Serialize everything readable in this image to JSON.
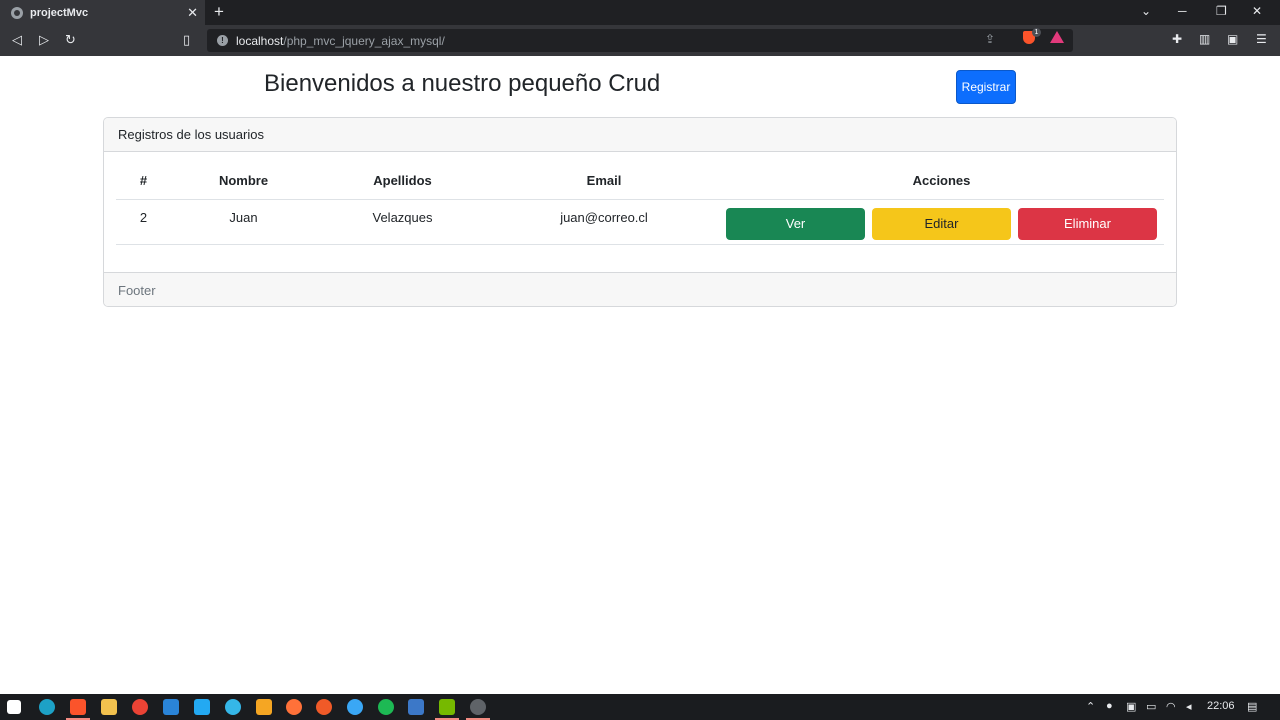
{
  "browser": {
    "tab_title": "projectMvc",
    "tab_close": "✕",
    "new_tab": "+",
    "url_host": "localhost",
    "url_path": "/php_mvc_jquery_ajax_mysql/",
    "shield_count": "1",
    "window_minimize": "─",
    "window_maximize": "❐",
    "window_close": "✕",
    "tab_dropdown": "⌄",
    "icons": [
      "back-icon",
      "forward-icon",
      "reload-icon",
      "bookmark-icon",
      "info-icon",
      "share-icon",
      "brave-shield-icon",
      "brave-rewards-icon",
      "extensions-icon",
      "sidebar-icon",
      "wallet-icon",
      "menu-icon"
    ]
  },
  "page": {
    "title": "Bienvenidos a nuestro pequeño Crud",
    "register_button": "Registrar",
    "card": {
      "header": "Registros de los usuarios",
      "footer": "Footer",
      "columns": [
        "#",
        "Nombre",
        "Apellidos",
        "Email",
        "Acciones"
      ],
      "rows": [
        {
          "id": "2",
          "nombre": "Juan",
          "apellidos": "Velazques",
          "email": "juan@correo.cl"
        }
      ],
      "actions": {
        "view": "Ver",
        "edit": "Editar",
        "delete": "Eliminar"
      }
    }
  },
  "colors": {
    "primary": "#0d6efd",
    "success": "#198754",
    "warning": "#f5c61a",
    "danger": "#dc3545"
  },
  "taskbar": {
    "clock": "22:06"
  }
}
